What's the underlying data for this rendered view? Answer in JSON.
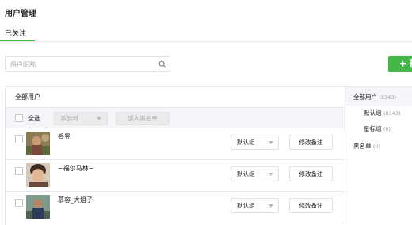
{
  "page": {
    "title": "用户管理"
  },
  "tabs": [
    {
      "label": "已关注",
      "active": true
    }
  ],
  "search": {
    "placeholder": "用户昵称",
    "icon": "search-icon"
  },
  "new_button": {
    "label": "+ 新"
  },
  "main": {
    "header": "全部用户",
    "toolbar": {
      "select_all_label": "全选",
      "add_to_label": "添加到",
      "blacklist_label": "加入黑名单"
    },
    "users": [
      {
        "name": "香昱",
        "group": "默认组",
        "remark_label": "修改备注"
      },
      {
        "name": "~福尔马林~",
        "group": "默认组",
        "remark_label": "修改备注"
      },
      {
        "name": "慕容_大姐子",
        "group": "默认组",
        "remark_label": "修改备注"
      }
    ]
  },
  "sidebar": {
    "all": {
      "label": "全部用户",
      "count": "(8343)"
    },
    "default": {
      "label": "默认组",
      "count": "(8343)"
    },
    "star": {
      "label": "星标组",
      "count": "(0)"
    },
    "blacklist": {
      "label": "黑名单",
      "count": "(0)"
    }
  },
  "colors": {
    "accent": "#44b549",
    "toolbar_bg": "#f4f5f9",
    "border": "#e7e7eb"
  }
}
